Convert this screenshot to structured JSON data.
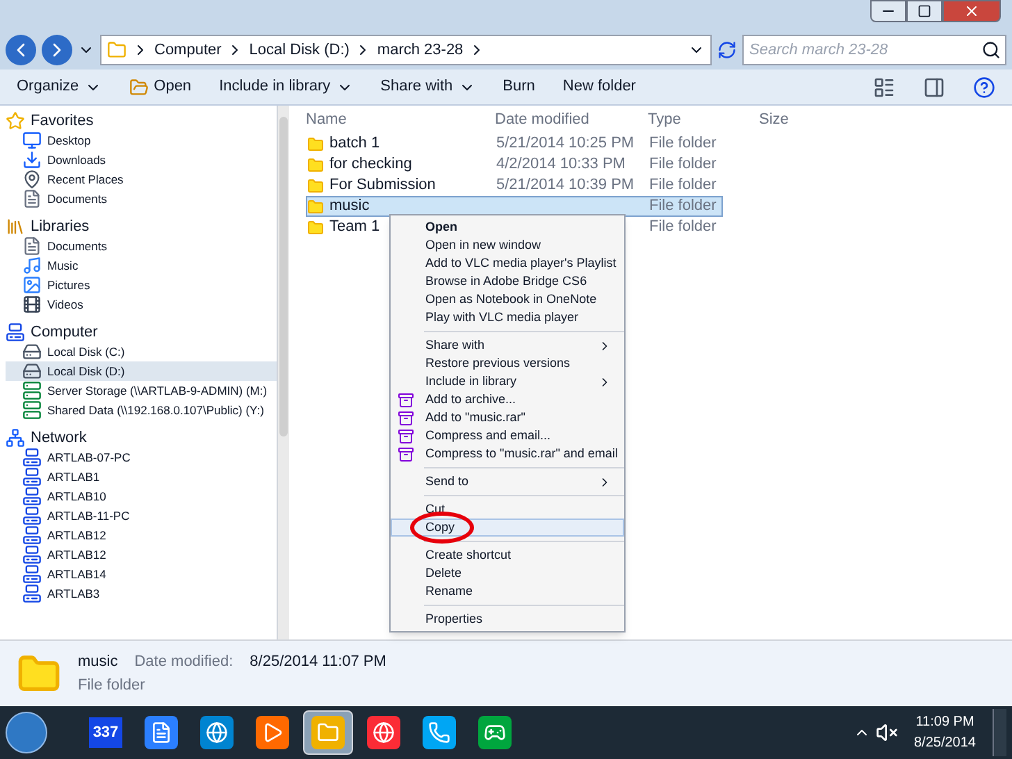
{
  "address": {
    "crumbs": [
      "Computer",
      "Local Disk (D:)",
      "march 23-28"
    ]
  },
  "search": {
    "placeholder": "Search march 23-28"
  },
  "toolbar": {
    "buttons": [
      {
        "label": "Organize",
        "kind": "menu"
      },
      {
        "label": "Open",
        "kind": "open"
      },
      {
        "label": "Include in library",
        "kind": "menu"
      },
      {
        "label": "Share with",
        "kind": "menu"
      },
      {
        "label": "Burn",
        "kind": "plain"
      },
      {
        "label": "New folder",
        "kind": "plain"
      }
    ]
  },
  "sidebar": {
    "groups": [
      {
        "label": "Favorites",
        "kind": "star",
        "children": [
          {
            "label": "Desktop",
            "kind": "desktop",
            "selected": false
          },
          {
            "label": "Downloads",
            "kind": "download",
            "selected": false
          },
          {
            "label": "Recent Places",
            "kind": "places",
            "selected": false
          },
          {
            "label": "Documents",
            "kind": "document",
            "selected": false
          }
        ]
      },
      {
        "label": "Libraries",
        "kind": "library",
        "children": [
          {
            "label": "Documents",
            "kind": "document",
            "selected": false
          },
          {
            "label": "Music",
            "kind": "music",
            "selected": false
          },
          {
            "label": "Pictures",
            "kind": "pictures",
            "selected": false
          },
          {
            "label": "Videos",
            "kind": "videos",
            "selected": false
          }
        ]
      },
      {
        "label": "Computer",
        "kind": "computer",
        "children": [
          {
            "label": "Local Disk (C:)",
            "kind": "drive",
            "selected": false
          },
          {
            "label": "Local Disk (D:)",
            "kind": "drive",
            "selected": true
          },
          {
            "label": "Server Storage (\\\\ARTLAB-9-ADMIN) (M:)",
            "kind": "netdrive",
            "selected": false
          },
          {
            "label": "Shared Data (\\\\192.168.0.107\\Public) (Y:)",
            "kind": "netdrive",
            "selected": false
          }
        ]
      },
      {
        "label": "Network",
        "kind": "network",
        "children": [
          {
            "label": "ARTLAB-07-PC",
            "kind": "pc",
            "selected": false
          },
          {
            "label": "ARTLAB1",
            "kind": "pc",
            "selected": false
          },
          {
            "label": "ARTLAB10",
            "kind": "pc",
            "selected": false
          },
          {
            "label": "ARTLAB-11-PC",
            "kind": "pc",
            "selected": false
          },
          {
            "label": "ARTLAB12",
            "kind": "pc",
            "selected": false
          },
          {
            "label": "ARTLAB12",
            "kind": "pc",
            "selected": false
          },
          {
            "label": "ARTLAB14",
            "kind": "pc",
            "selected": false
          },
          {
            "label": "ARTLAB3",
            "kind": "pc",
            "selected": false
          }
        ]
      }
    ]
  },
  "table": {
    "columns": [
      "Name",
      "Date modified",
      "Type",
      "Size"
    ],
    "rows": [
      {
        "name": "batch 1",
        "date": "5/21/2014 10:25 PM",
        "type": "File folder",
        "selected": false
      },
      {
        "name": "for checking",
        "date": "4/2/2014 10:33 PM",
        "type": "File folder",
        "selected": false
      },
      {
        "name": "For Submission",
        "date": "5/21/2014 10:39 PM",
        "type": "File folder",
        "selected": false
      },
      {
        "name": "music",
        "type": "File folder",
        "selected": true
      },
      {
        "name": "Team 1",
        "type": "File folder",
        "selected": false
      }
    ]
  },
  "context_menu": {
    "items": [
      {
        "kind": "default",
        "label": "Open",
        "submenu": false,
        "selected": false
      },
      {
        "kind": "item",
        "label": "Open in new window",
        "submenu": false,
        "selected": false
      },
      {
        "kind": "item",
        "label": "Add to VLC media player's Playlist",
        "submenu": false,
        "selected": false
      },
      {
        "kind": "item",
        "label": "Browse in Adobe Bridge CS6",
        "submenu": false,
        "selected": false
      },
      {
        "kind": "item",
        "label": "Open as Notebook in OneNote",
        "submenu": false,
        "selected": false
      },
      {
        "kind": "item",
        "label": "Play with VLC media player",
        "submenu": false,
        "selected": false
      },
      {
        "kind": "separator"
      },
      {
        "kind": "item",
        "label": "Share with",
        "submenu": true,
        "selected": false
      },
      {
        "kind": "item",
        "label": "Restore previous versions",
        "submenu": false,
        "selected": false
      },
      {
        "kind": "item",
        "label": "Include in library",
        "submenu": true,
        "selected": false
      },
      {
        "kind": "archive",
        "label": "Add to archive...",
        "submenu": false,
        "selected": false
      },
      {
        "kind": "archive",
        "label": "Add to \"music.rar\"",
        "submenu": false,
        "selected": false
      },
      {
        "kind": "archive",
        "label": "Compress and email...",
        "submenu": false,
        "selected": false
      },
      {
        "kind": "archive",
        "label": "Compress to \"music.rar\" and email",
        "submenu": false,
        "selected": false
      },
      {
        "kind": "separator"
      },
      {
        "kind": "item",
        "label": "Send to",
        "submenu": true,
        "selected": false
      },
      {
        "kind": "separator"
      },
      {
        "kind": "item",
        "label": "Cut",
        "submenu": false,
        "selected": false
      },
      {
        "kind": "item",
        "label": "Copy",
        "submenu": false,
        "selected": true
      },
      {
        "kind": "separator"
      },
      {
        "kind": "item",
        "label": "Create shortcut",
        "submenu": false,
        "selected": false
      },
      {
        "kind": "item",
        "label": "Delete",
        "submenu": false,
        "selected": false
      },
      {
        "kind": "item",
        "label": "Rename",
        "submenu": false,
        "selected": false
      },
      {
        "kind": "separator"
      },
      {
        "kind": "item",
        "label": "Properties",
        "submenu": false,
        "selected": false
      }
    ]
  },
  "details_pane": {
    "name": "music",
    "date_label": "Date modified:",
    "date": "8/25/2014 11:07 PM",
    "type": "File folder"
  },
  "taskbar": {
    "apps": [
      {
        "kind": "calendar",
        "label": "337",
        "selected": false
      },
      {
        "kind": "word",
        "selected": false
      },
      {
        "kind": "browser",
        "selected": false
      },
      {
        "kind": "media",
        "selected": false
      },
      {
        "kind": "explorer",
        "selected": true
      },
      {
        "kind": "chrome",
        "selected": false
      },
      {
        "kind": "skype",
        "selected": false
      },
      {
        "kind": "game",
        "selected": false
      }
    ],
    "time": "11:09 PM",
    "date": "8/25/2014"
  }
}
